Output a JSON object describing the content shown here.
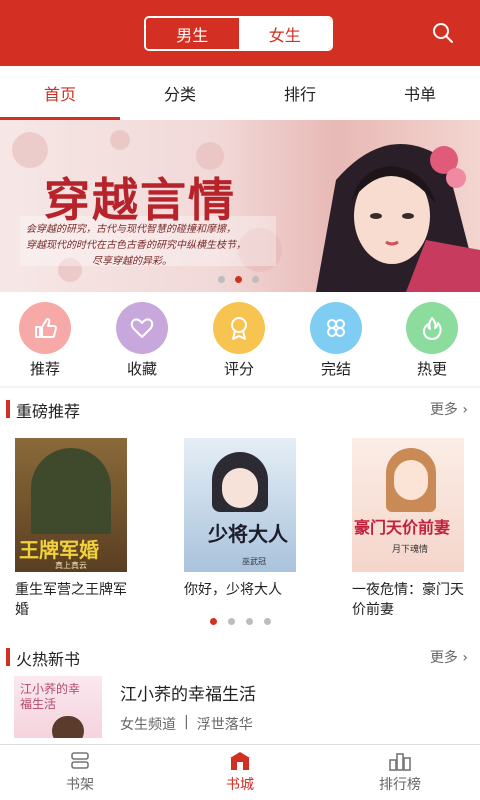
{
  "header": {
    "gender_male": "男生",
    "gender_female": "女生"
  },
  "tabs": [
    {
      "label": "首页",
      "active": true
    },
    {
      "label": "分类"
    },
    {
      "label": "排行"
    },
    {
      "label": "书单"
    }
  ],
  "banner": {
    "title": "穿越言情",
    "lines": [
      "会穿越的研究，古代与现代智慧的碰撞和摩擦，",
      "穿越现代的时代在古色古香的研究中纵横生枝节，",
      "尽享穿越的异彩。"
    ]
  },
  "quick_links": [
    {
      "label": "推荐",
      "icon": "thumbs-up-icon",
      "color": "#f7a9a8"
    },
    {
      "label": "收藏",
      "icon": "heart-icon",
      "color": "#c8a8dc"
    },
    {
      "label": "评分",
      "icon": "award-icon",
      "color": "#f7c451"
    },
    {
      "label": "完结",
      "icon": "clover-icon",
      "color": "#7fcdf2"
    },
    {
      "label": "热更",
      "icon": "fire-icon",
      "color": "#8bdc9d"
    }
  ],
  "recommend": {
    "title": "重磅推荐",
    "more": "更多",
    "books": [
      {
        "title": "重生军营之王牌军婚",
        "cover_text": "王牌军婚",
        "author": "真上真云"
      },
      {
        "title": "你好，少将大人",
        "cover_text": "少将大人",
        "author": "巫武冠"
      },
      {
        "title": "一夜危情：豪门天价前妻",
        "cover_text": "豪门天价前妻",
        "author": "月下魂情"
      }
    ]
  },
  "hot_new": {
    "title": "火热新书",
    "more": "更多",
    "book": {
      "title": "江小荞的幸福生活",
      "cover_text": "江小荞的幸福生活",
      "channel": "女生频道",
      "separator": "|",
      "author": "浮世落华"
    }
  },
  "bottom_nav": [
    {
      "label": "书架"
    },
    {
      "label": "书城",
      "active": true
    },
    {
      "label": "排行榜"
    }
  ],
  "colors": {
    "brand": "#d32f22"
  }
}
